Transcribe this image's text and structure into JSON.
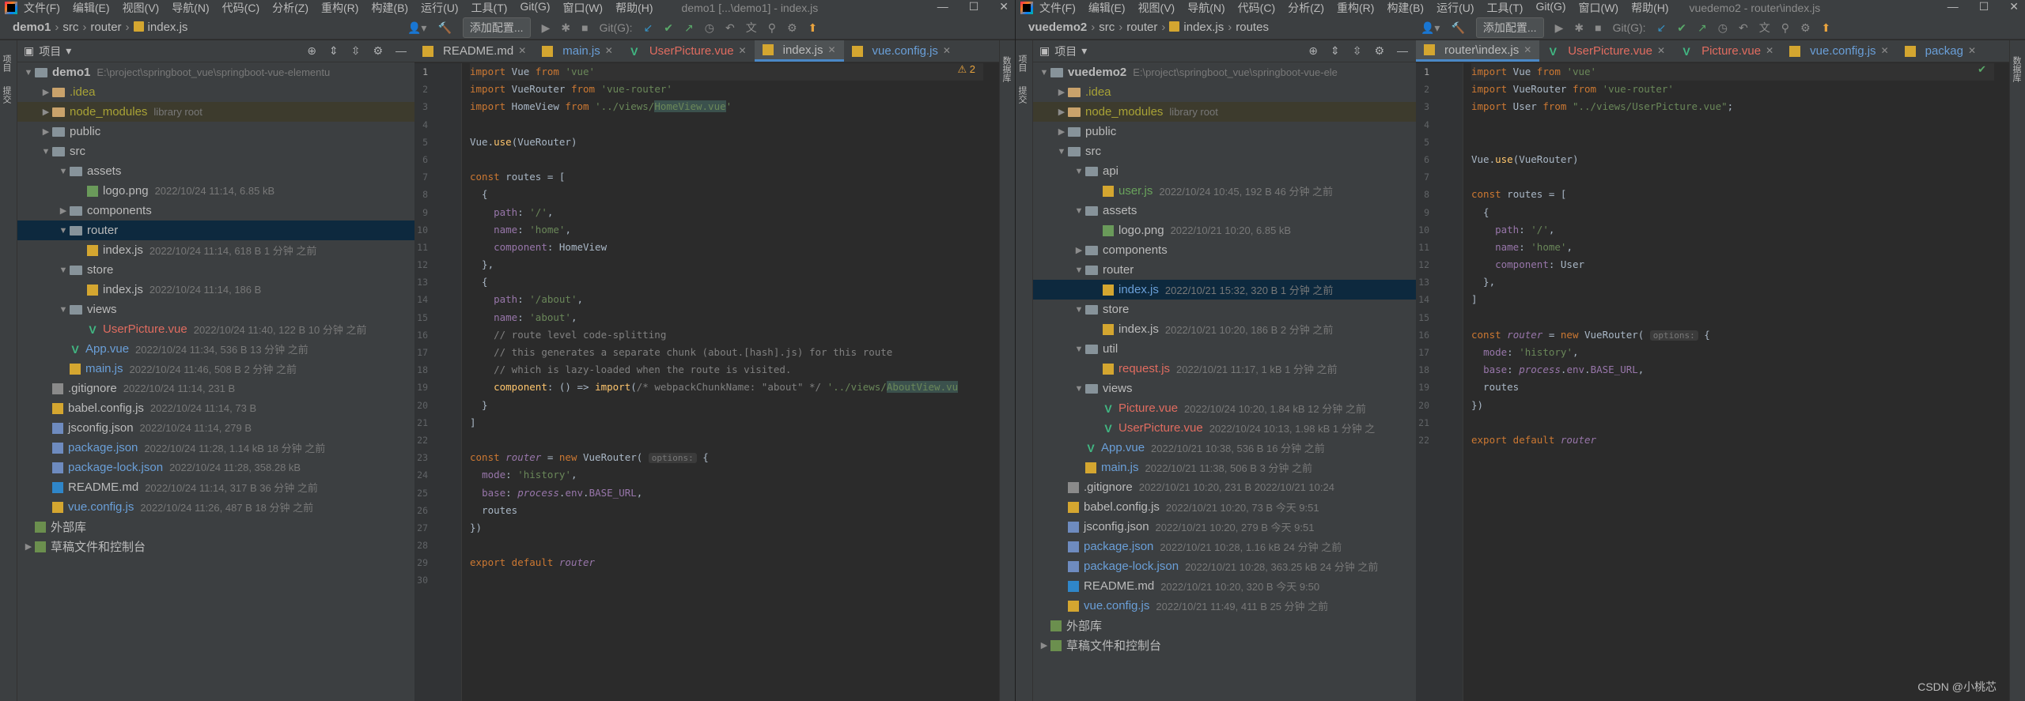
{
  "left": {
    "menu": [
      "文件(F)",
      "编辑(E)",
      "视图(V)",
      "导航(N)",
      "代码(C)",
      "分析(Z)",
      "重构(R)",
      "构建(B)",
      "运行(U)",
      "工具(T)",
      "Git(G)",
      "窗口(W)",
      "帮助(H)"
    ],
    "window_title": "demo1 [...\\demo1] - index.js",
    "breadcrumb": [
      "demo1",
      "src",
      "router",
      "index.js"
    ],
    "add_config": "添加配置...",
    "git_label": "Git(G):",
    "side_label": "项目",
    "side_label2": "提交",
    "project_header": "项目",
    "tree": [
      {
        "depth": 0,
        "arrow": "▼",
        "type": "folder",
        "name": "demo1",
        "meta": "E:\\project\\springboot_vue\\springboot-vue-elementu",
        "style": "b"
      },
      {
        "depth": 1,
        "arrow": "▶",
        "type": "folder-orange",
        "name": ".idea",
        "meta": "",
        "style": "yellow"
      },
      {
        "depth": 1,
        "arrow": "▶",
        "type": "folder-orange",
        "name": "node_modules",
        "meta": "library root",
        "style": "yellow",
        "hl": true
      },
      {
        "depth": 1,
        "arrow": "▶",
        "type": "folder",
        "name": "public",
        "meta": ""
      },
      {
        "depth": 1,
        "arrow": "▼",
        "type": "folder",
        "name": "src",
        "meta": ""
      },
      {
        "depth": 2,
        "arrow": "▼",
        "type": "folder",
        "name": "assets",
        "meta": ""
      },
      {
        "depth": 3,
        "arrow": "",
        "type": "png",
        "name": "logo.png",
        "meta": "2022/10/24 11:14, 6.85 kB"
      },
      {
        "depth": 2,
        "arrow": "▶",
        "type": "folder",
        "name": "components",
        "meta": ""
      },
      {
        "depth": 2,
        "arrow": "▼",
        "type": "folder",
        "name": "router",
        "meta": "",
        "sel": true
      },
      {
        "depth": 3,
        "arrow": "",
        "type": "js",
        "name": "index.js",
        "meta": "2022/10/24 11:14, 618 B 1 分钟 之前"
      },
      {
        "depth": 2,
        "arrow": "▼",
        "type": "folder",
        "name": "store",
        "meta": ""
      },
      {
        "depth": 3,
        "arrow": "",
        "type": "js",
        "name": "index.js",
        "meta": "2022/10/24 11:14, 186 B"
      },
      {
        "depth": 2,
        "arrow": "▼",
        "type": "folder",
        "name": "views",
        "meta": ""
      },
      {
        "depth": 3,
        "arrow": "",
        "type": "vue",
        "name": "UserPicture.vue",
        "meta": "2022/10/24 11:40, 122 B 10 分钟 之前",
        "style": "red"
      },
      {
        "depth": 2,
        "arrow": "",
        "type": "vue",
        "name": "App.vue",
        "meta": "2022/10/24 11:34, 536 B 13 分钟 之前",
        "style": "blue"
      },
      {
        "depth": 2,
        "arrow": "",
        "type": "js",
        "name": "main.js",
        "meta": "2022/10/24 11:46, 508 B 2 分钟 之前",
        "style": "blue"
      },
      {
        "depth": 1,
        "arrow": "",
        "type": "git",
        "name": ".gitignore",
        "meta": "2022/10/24 11:14, 231 B"
      },
      {
        "depth": 1,
        "arrow": "",
        "type": "js",
        "name": "babel.config.js",
        "meta": "2022/10/24 11:14, 73 B"
      },
      {
        "depth": 1,
        "arrow": "",
        "type": "json",
        "name": "jsconfig.json",
        "meta": "2022/10/24 11:14, 279 B"
      },
      {
        "depth": 1,
        "arrow": "",
        "type": "json",
        "name": "package.json",
        "meta": "2022/10/24 11:28, 1.14 kB 18 分钟 之前",
        "style": "blue"
      },
      {
        "depth": 1,
        "arrow": "",
        "type": "json",
        "name": "package-lock.json",
        "meta": "2022/10/24 11:28, 358.28 kB",
        "style": "blue"
      },
      {
        "depth": 1,
        "arrow": "",
        "type": "md",
        "name": "README.md",
        "meta": "2022/10/24 11:14, 317 B 36 分钟 之前"
      },
      {
        "depth": 1,
        "arrow": "",
        "type": "js",
        "name": "vue.config.js",
        "meta": "2022/10/24 11:26, 487 B 18 分钟 之前",
        "style": "blue"
      },
      {
        "depth": 0,
        "arrow": "",
        "type": "lib",
        "name": "外部库",
        "meta": ""
      },
      {
        "depth": 0,
        "arrow": "▶",
        "type": "lib",
        "name": "草稿文件和控制台",
        "meta": ""
      }
    ],
    "tabs": [
      {
        "label": "README.md",
        "style": ""
      },
      {
        "label": "main.js",
        "style": "blue"
      },
      {
        "label": "UserPicture.vue",
        "style": "red"
      },
      {
        "label": "index.js",
        "style": "",
        "active": true
      },
      {
        "label": "vue.config.js",
        "style": "blue"
      }
    ],
    "warn": "⚠ 2",
    "code": [
      "<span class='kw'>import</span> Vue <span class='kw'>from</span> <span class='str'>'vue'</span>",
      "<span class='kw'>import</span> VueRouter <span class='kw'>from</span> <span class='str'>'vue-router'</span>",
      "<span class='kw'>import</span> HomeView <span class='kw'>from</span> <span class='str'>'../views/<span class=\"mark\">HomeView.vue</span>'</span>",
      "",
      "Vue.<span class='fn'>use</span>(VueRouter)",
      "",
      "<span class='kw'>const</span> routes = [",
      "  {",
      "    <span class='prop'>path</span>: <span class='str'>'/'</span>,",
      "    <span class='prop'>name</span>: <span class='str'>'home'</span>,",
      "    <span class='prop'>component</span>: HomeView",
      "  },",
      "  {",
      "    <span class='prop'>path</span>: <span class='str'>'/about'</span>,",
      "    <span class='prop'>name</span>: <span class='str'>'about'</span>,",
      "    <span class='cmt'>// route level code-splitting</span>",
      "    <span class='cmt'>// this generates a separate chunk (about.[hash].js) for this route</span>",
      "    <span class='cmt'>// which is lazy-loaded when the route is visited.</span>",
      "    <span class='fn'>component</span>: () => <span class='fn'>import</span>(<span class='cmt'>/* webpackChunkName: \"about\" */</span> <span class='str'>'../views/<span class=\"mark\">AboutView.vu</span></span>",
      "  }",
      "]",
      "",
      "<span class='kw'>const</span> <span class='ital'>router</span> = <span class='kw'>new</span> VueRouter( <span class='hint'>options:</span> {",
      "  <span class='prop'>mode</span>: <span class='str'>'history'</span>,",
      "  <span class='prop'>base</span>: <span class='ital'>process</span>.<span class='prop'>env</span>.<span class='prop'>BASE_URL</span>,",
      "  routes",
      "})",
      "",
      "<span class='kw'>export default</span> <span class='ital'>router</span>",
      ""
    ]
  },
  "right": {
    "menu": [
      "文件(F)",
      "编辑(E)",
      "视图(V)",
      "导航(N)",
      "代码(C)",
      "分析(Z)",
      "重构(R)",
      "构建(B)",
      "运行(U)",
      "工具(T)",
      "Git(G)",
      "窗口(W)",
      "帮助(H)"
    ],
    "window_title": "vuedemo2 - router\\index.js",
    "breadcrumb": [
      "vuedemo2",
      "src",
      "router",
      "index.js",
      "routes"
    ],
    "add_config": "添加配置...",
    "git_label": "Git(G):",
    "side_label": "项目",
    "side_label2": "提交",
    "project_header": "项目",
    "tree": [
      {
        "depth": 0,
        "arrow": "▼",
        "type": "folder",
        "name": "vuedemo2",
        "meta": "E:\\project\\springboot_vue\\springboot-vue-ele",
        "style": "b"
      },
      {
        "depth": 1,
        "arrow": "▶",
        "type": "folder-orange",
        "name": ".idea",
        "meta": "",
        "style": "yellow"
      },
      {
        "depth": 1,
        "arrow": "▶",
        "type": "folder-orange",
        "name": "node_modules",
        "meta": "library root",
        "style": "yellow",
        "hl": true
      },
      {
        "depth": 1,
        "arrow": "▶",
        "type": "folder",
        "name": "public",
        "meta": ""
      },
      {
        "depth": 1,
        "arrow": "▼",
        "type": "folder",
        "name": "src",
        "meta": ""
      },
      {
        "depth": 2,
        "arrow": "▼",
        "type": "folder",
        "name": "api",
        "meta": ""
      },
      {
        "depth": 3,
        "arrow": "",
        "type": "js",
        "name": "user.js",
        "meta": "2022/10/24 10:45, 192 B 46 分钟 之前",
        "style": "green"
      },
      {
        "depth": 2,
        "arrow": "▼",
        "type": "folder",
        "name": "assets",
        "meta": ""
      },
      {
        "depth": 3,
        "arrow": "",
        "type": "png",
        "name": "logo.png",
        "meta": "2022/10/21 10:20, 6.85 kB"
      },
      {
        "depth": 2,
        "arrow": "▶",
        "type": "folder",
        "name": "components",
        "meta": ""
      },
      {
        "depth": 2,
        "arrow": "▼",
        "type": "folder",
        "name": "router",
        "meta": ""
      },
      {
        "depth": 3,
        "arrow": "",
        "type": "js",
        "name": "index.js",
        "meta": "2022/10/21 15:32, 320 B 1 分钟 之前",
        "style": "blue",
        "sel": true
      },
      {
        "depth": 2,
        "arrow": "▼",
        "type": "folder",
        "name": "store",
        "meta": ""
      },
      {
        "depth": 3,
        "arrow": "",
        "type": "js",
        "name": "index.js",
        "meta": "2022/10/21 10:20, 186 B 2 分钟 之前"
      },
      {
        "depth": 2,
        "arrow": "▼",
        "type": "folder",
        "name": "util",
        "meta": ""
      },
      {
        "depth": 3,
        "arrow": "",
        "type": "js",
        "name": "request.js",
        "meta": "2022/10/21 11:17, 1 kB 1 分钟 之前",
        "style": "red"
      },
      {
        "depth": 2,
        "arrow": "▼",
        "type": "folder",
        "name": "views",
        "meta": ""
      },
      {
        "depth": 3,
        "arrow": "",
        "type": "vue",
        "name": "Picture.vue",
        "meta": "2022/10/24 10:20, 1.84 kB 12 分钟 之前",
        "style": "red"
      },
      {
        "depth": 3,
        "arrow": "",
        "type": "vue",
        "name": "UserPicture.vue",
        "meta": "2022/10/24 10:13, 1.98 kB 1 分钟 之",
        "style": "red"
      },
      {
        "depth": 2,
        "arrow": "",
        "type": "vue",
        "name": "App.vue",
        "meta": "2022/10/21 10:38, 536 B 16 分钟 之前",
        "style": "blue"
      },
      {
        "depth": 2,
        "arrow": "",
        "type": "js",
        "name": "main.js",
        "meta": "2022/10/21 11:38, 506 B 3 分钟 之前",
        "style": "blue"
      },
      {
        "depth": 1,
        "arrow": "",
        "type": "git",
        "name": ".gitignore",
        "meta": "2022/10/21 10:20, 231 B 2022/10/21 10:24"
      },
      {
        "depth": 1,
        "arrow": "",
        "type": "js",
        "name": "babel.config.js",
        "meta": "2022/10/21 10:20, 73 B 今天 9:51"
      },
      {
        "depth": 1,
        "arrow": "",
        "type": "json",
        "name": "jsconfig.json",
        "meta": "2022/10/21 10:20, 279 B 今天 9:51"
      },
      {
        "depth": 1,
        "arrow": "",
        "type": "json",
        "name": "package.json",
        "meta": "2022/10/21 10:28, 1.16 kB 24 分钟 之前",
        "style": "blue"
      },
      {
        "depth": 1,
        "arrow": "",
        "type": "json",
        "name": "package-lock.json",
        "meta": "2022/10/21 10:28, 363.25 kB 24 分钟 之前",
        "style": "blue"
      },
      {
        "depth": 1,
        "arrow": "",
        "type": "md",
        "name": "README.md",
        "meta": "2022/10/21 10:20, 320 B 今天 9:50"
      },
      {
        "depth": 1,
        "arrow": "",
        "type": "js",
        "name": "vue.config.js",
        "meta": "2022/10/21 11:49, 411 B 25 分钟 之前",
        "style": "blue"
      },
      {
        "depth": 0,
        "arrow": "",
        "type": "lib",
        "name": "外部库",
        "meta": ""
      },
      {
        "depth": 0,
        "arrow": "▶",
        "type": "lib",
        "name": "草稿文件和控制台",
        "meta": ""
      }
    ],
    "tabs": [
      {
        "label": "router\\index.js",
        "style": "",
        "active": true
      },
      {
        "label": "UserPicture.vue",
        "style": "red"
      },
      {
        "label": "Picture.vue",
        "style": "red"
      },
      {
        "label": "vue.config.js",
        "style": "blue"
      },
      {
        "label": "packag",
        "style": "blue"
      }
    ],
    "warn": "✔",
    "code": [
      "<span class='kw'>import</span> Vue <span class='kw'>from</span> <span class='str'>'vue'</span>",
      "<span class='kw'>import</span> VueRouter <span class='kw'>from</span> <span class='str'>'vue-router'</span>",
      "<span class='kw'>import</span> User <span class='kw'>from</span> <span class='str'>\"../views/UserPicture.vue\"</span>;",
      "",
      "",
      "Vue.<span class='fn'>use</span>(VueRouter)",
      "",
      "<span class='kw'>const</span> routes = [",
      "  {",
      "    <span class='prop'>path</span>: <span class='str'>'/'</span>,",
      "    <span class='prop'>name</span>: <span class='str'>'home'</span>,",
      "    <span class='prop'>component</span>: User",
      "  },",
      "]",
      "",
      "<span class='kw'>const</span> <span class='ital'>router</span> = <span class='kw'>new</span> VueRouter( <span class='hint'>options:</span> {",
      "  <span class='prop'>mode</span>: <span class='str'>'history'</span>,",
      "  <span class='prop'>base</span>: <span class='ital'>process</span>.<span class='prop'>env</span>.<span class='prop'>BASE_URL</span>,",
      "  routes",
      "})",
      "",
      "<span class='kw'>export default</span> <span class='ital'>router</span>"
    ]
  },
  "right_strip_label": "数据库",
  "watermark": "CSDN @小桃芯"
}
